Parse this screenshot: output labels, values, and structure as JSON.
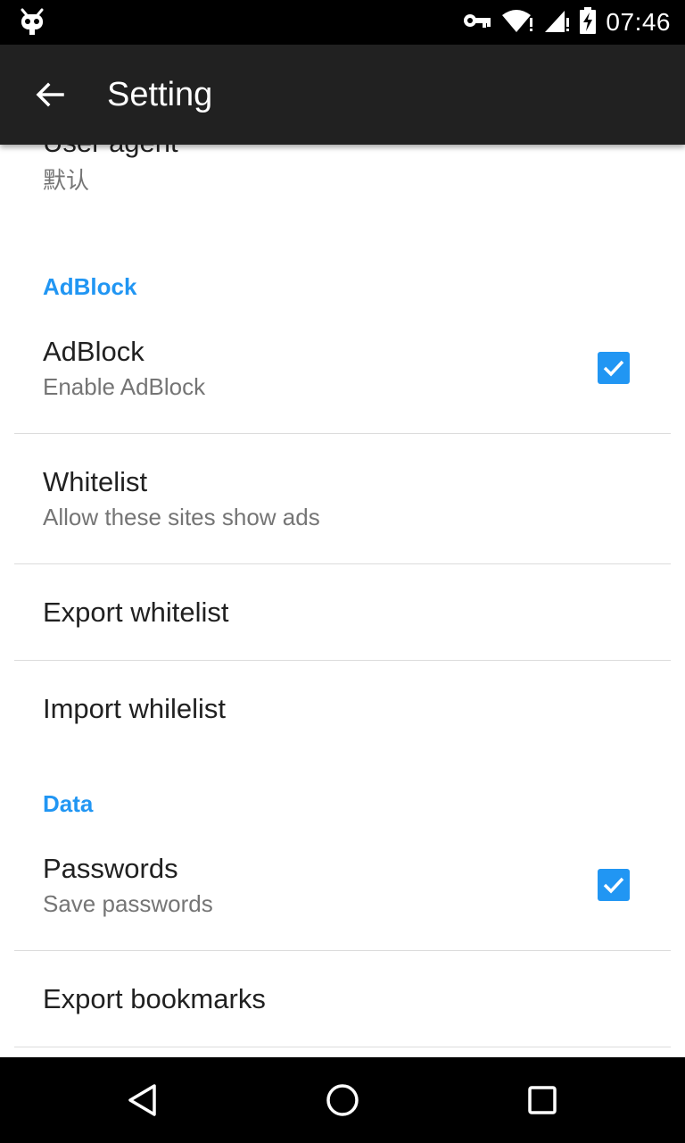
{
  "status_bar": {
    "time": "07:46",
    "left_icon": "cyanogen-mascot-icon",
    "right_icons": [
      "key-icon",
      "wifi-alert-icon",
      "signal-alert-icon",
      "battery-charging-icon"
    ]
  },
  "toolbar": {
    "back_icon": "arrow-back-icon",
    "title": "Setting"
  },
  "settings": {
    "user_agent": {
      "title": "User agent",
      "summary": "默认"
    },
    "adblock_section": "AdBlock",
    "adblock": {
      "title": "AdBlock",
      "summary": "Enable AdBlock",
      "checked": true
    },
    "whitelist": {
      "title": "Whitelist",
      "summary": "Allow these sites show ads"
    },
    "export_whitelist": {
      "title": "Export whitelist"
    },
    "import_whitelist": {
      "title": "Import whilelist"
    },
    "data_section": "Data",
    "passwords": {
      "title": "Passwords",
      "summary": "Save passwords",
      "checked": true
    },
    "export_bookmarks": {
      "title": "Export bookmarks"
    }
  },
  "nav_bar": {
    "buttons": [
      "back-triangle-icon",
      "home-circle-icon",
      "recents-square-icon"
    ]
  },
  "colors": {
    "accent": "#2196f3",
    "toolbar": "#212121",
    "status_bar": "#000000",
    "title_text": "#212121",
    "summary_text": "#757575"
  }
}
